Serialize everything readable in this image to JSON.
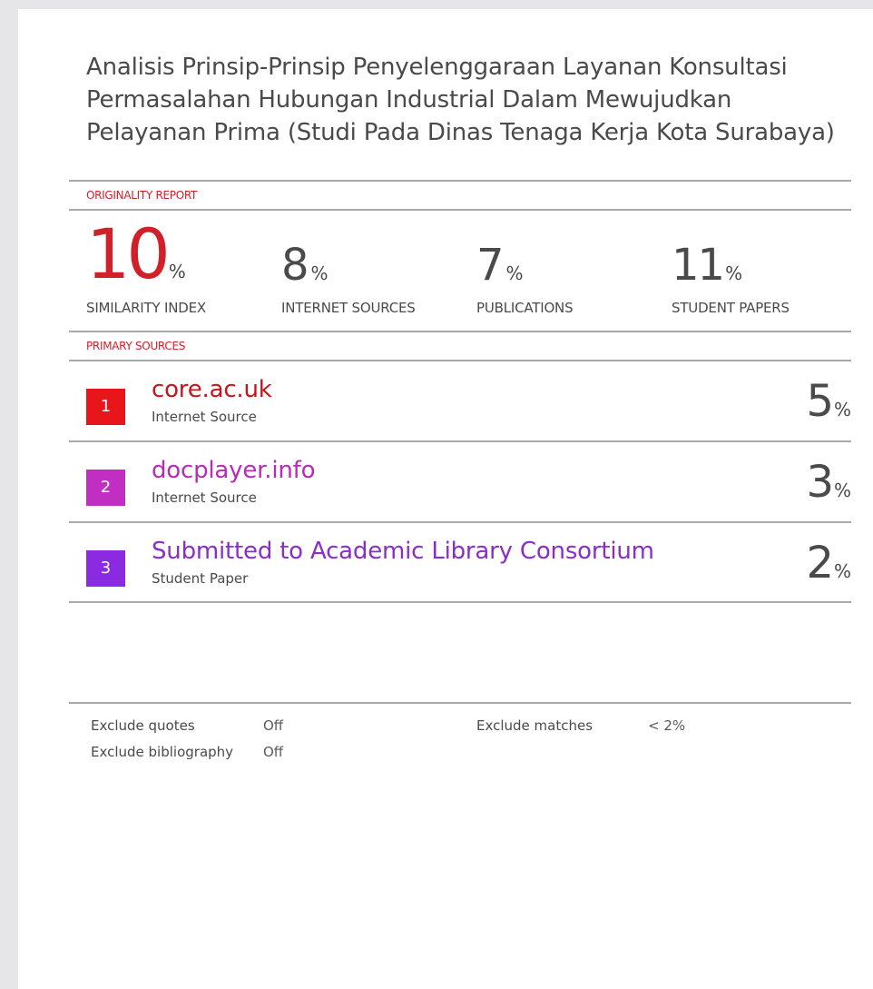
{
  "title": "Analisis Prinsip-Prinsip Penyelenggaraan Layanan Konsultasi Permasalahan Hubungan Industrial Dalam Mewujudkan Pelayanan Prima (Studi Pada Dinas Tenaga Kerja Kota Surabaya)",
  "originality_label": "ORIGINALITY REPORT",
  "percent_sign": "%",
  "stats": [
    {
      "value": "10",
      "label": "SIMILARITY INDEX",
      "color": "#d0202a"
    },
    {
      "value": "8",
      "label": "INTERNET SOURCES",
      "color": "#4a4a4a"
    },
    {
      "value": "7",
      "label": "PUBLICATIONS",
      "color": "#4a4a4a"
    },
    {
      "value": "11",
      "label": "STUDENT PAPERS",
      "color": "#4a4a4a"
    }
  ],
  "primary_label": "PRIMARY SOURCES",
  "sources": [
    {
      "rank": "1",
      "name": "core.ac.uk",
      "type": "Internet Source",
      "percent": "5",
      "color": "#e8161b",
      "text_color": "#c8141c"
    },
    {
      "rank": "2",
      "name": "docplayer.info",
      "type": "Internet Source",
      "percent": "3",
      "color": "#c02ec2",
      "text_color": "#b62cb8"
    },
    {
      "rank": "3",
      "name": "Submitted to Academic Library Consortium",
      "type": "Student Paper",
      "percent": "2",
      "color": "#8a2be2",
      "text_color": "#8a2ec9"
    }
  ],
  "exclude": {
    "quotes_label": "Exclude quotes",
    "quotes_value": "Off",
    "bibliography_label": "Exclude bibliography",
    "bibliography_value": "Off",
    "matches_label": "Exclude matches",
    "matches_value": "< 2%"
  }
}
